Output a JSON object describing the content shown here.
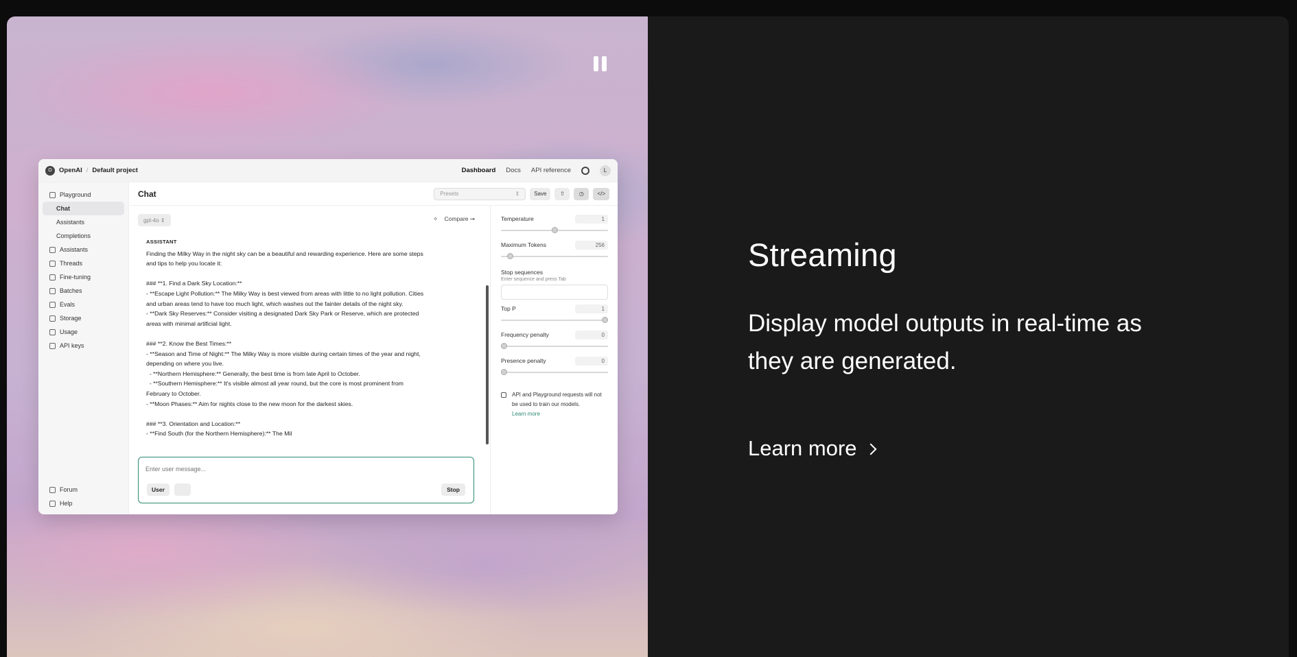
{
  "feature": {
    "heading": "Streaming",
    "description": "Display model outputs in real-time as they are generated.",
    "learn_more": "Learn more"
  },
  "app": {
    "org": "OpenAI",
    "project": "Default project",
    "logo_letter": "O",
    "nav": [
      "Dashboard",
      "Docs",
      "API reference"
    ],
    "avatar": "L",
    "sidebar": {
      "items": [
        {
          "label": "Playground",
          "icon": "playground-icon"
        },
        {
          "label": "Chat",
          "sub": true,
          "active": true
        },
        {
          "label": "Assistants",
          "sub": true
        },
        {
          "label": "Completions",
          "sub": true
        },
        {
          "label": "Assistants",
          "icon": "assistants-icon"
        },
        {
          "label": "Threads",
          "icon": "threads-icon"
        },
        {
          "label": "Fine-tuning",
          "icon": "fine-tuning-icon"
        },
        {
          "label": "Batches",
          "icon": "batches-icon"
        },
        {
          "label": "Evals",
          "icon": "evals-icon"
        },
        {
          "label": "Storage",
          "icon": "storage-icon"
        },
        {
          "label": "Usage",
          "icon": "usage-icon"
        },
        {
          "label": "API keys",
          "icon": "key-icon"
        }
      ],
      "bottom": [
        {
          "label": "Forum",
          "icon": "forum-icon"
        },
        {
          "label": "Help",
          "icon": "help-icon"
        }
      ]
    },
    "chat": {
      "title": "Chat",
      "presets_placeholder": "Presets",
      "save": "Save",
      "model": "gpt-4o",
      "compare": "Compare",
      "role": "ASSISTANT",
      "message": "Finding the Milky Way in the night sky can be a beautiful and rewarding experience. Here are some steps\nand tips to help you locate it:\n\n### **1. Find a Dark Sky Location:**\n- **Escape Light Pollution:** The Milky Way is best viewed from areas with little to no light pollution. Cities\nand urban areas tend to have too much light, which washes out the fainter details of the night sky.\n- **Dark Sky Reserves:** Consider visiting a designated Dark Sky Park or Reserve, which are protected\nareas with minimal artificial light.\n\n### **2. Know the Best Times:**\n- **Season and Time of Night:** The Milky Way is more visible during certain times of the year and night,\ndepending on where you live.\n  - **Northern Hemisphere:** Generally, the best time is from late April to October.\n  - **Southern Hemisphere:** It's visible almost all year round, but the core is most prominent from\nFebruary to October.\n- **Moon Phases:** Aim for nights close to the new moon for the darkest skies.\n\n### **3. Orientation and Location:**\n- **Find South (for the Northern Hemisphere):** The Mil",
      "input_placeholder": "Enter user message...",
      "user_button": "User",
      "stop_button": "Stop"
    },
    "params": {
      "temperature": {
        "label": "Temperature",
        "value": "1",
        "fraction": 0.5
      },
      "max_tokens": {
        "label": "Maximum Tokens",
        "value": "256",
        "fraction": 0.06
      },
      "stop_sequences": {
        "label": "Stop sequences",
        "hint": "Enter sequence and press Tab"
      },
      "top_p": {
        "label": "Top P",
        "value": "1",
        "fraction": 1.0
      },
      "frequency_penalty": {
        "label": "Frequency penalty",
        "value": "0",
        "fraction": 0.0
      },
      "presence_penalty": {
        "label": "Presence penalty",
        "value": "0",
        "fraction": 0.0
      },
      "notice": "API and Playground requests will not be used to train our models.",
      "notice_link": "Learn more"
    }
  },
  "colors": {
    "accent": "#2f8a72",
    "panel_bg": "#1a1a1a"
  }
}
